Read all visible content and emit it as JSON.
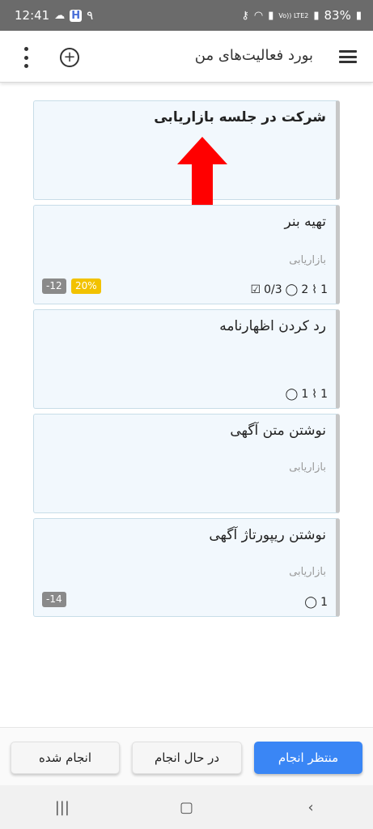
{
  "status_bar": {
    "time": "12:41",
    "extra": "۹",
    "network": "Vo)) LTE2",
    "battery": "83%"
  },
  "header": {
    "title": "بورد فعالیت‌های من",
    "add_icon": "plus-circle-icon",
    "menu_icon": "hamburger-menu-icon",
    "more_icon": "kebab-more-icon"
  },
  "cards": [
    {
      "title": "شرکت در جلسه بازاریابی",
      "bold": true
    },
    {
      "title": "تهیه بنر",
      "label": "بازاریابی",
      "attachments": "1",
      "comments": "2",
      "checklist": "0/3",
      "badge_percent": "20%",
      "badge_days": "-12"
    },
    {
      "title": "رد کردن اظهارنامه",
      "attachments": "1",
      "comments": "1"
    },
    {
      "title": "نوشتن متن آگهی",
      "label": "بازاریابی"
    },
    {
      "title": "نوشتن ریپورتاژ آگهی",
      "label": "بازاریابی",
      "comments": "1",
      "badge_days": "-14"
    }
  ],
  "annotation": {
    "arrow_color": "#ff0000"
  },
  "tabs": {
    "pending": "منتظر انجام",
    "in_progress": "در حال انجام",
    "done": "انجام شده"
  },
  "colors": {
    "primary": "#3a86f5",
    "card_bg": "#f2f8fd",
    "badge_yellow": "#f2c200",
    "badge_grey": "#8a8a8a"
  }
}
